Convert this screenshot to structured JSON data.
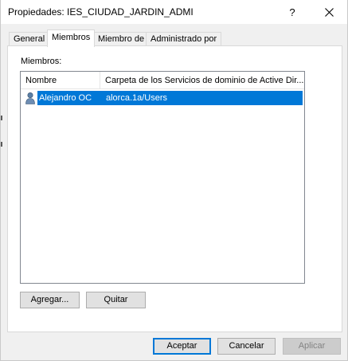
{
  "window": {
    "title": "Propiedades: IES_CIUDAD_JARDIN_ADMI",
    "help_label": "?",
    "close_icon": "close-icon"
  },
  "tabs": [
    {
      "label": "General",
      "active": false
    },
    {
      "label": "Miembros",
      "active": true
    },
    {
      "label": "Miembro de",
      "active": false
    },
    {
      "label": "Administrado por",
      "active": false
    }
  ],
  "members": {
    "label": "Miembros:",
    "columns": [
      "Nombre",
      "Carpeta de los Servicios de dominio de Active Dir..."
    ],
    "rows": [
      {
        "name": "Alejandro OC",
        "folder": "alorca.1a/Users",
        "icon": "user-icon",
        "selected": true
      }
    ],
    "add_label": "Agregar...",
    "remove_label": "Quitar"
  },
  "footer": {
    "ok_label": "Aceptar",
    "cancel_label": "Cancelar",
    "apply_label": "Aplicar"
  },
  "colors": {
    "selection": "#0078d7",
    "window_bg": "#f0f0f0"
  }
}
